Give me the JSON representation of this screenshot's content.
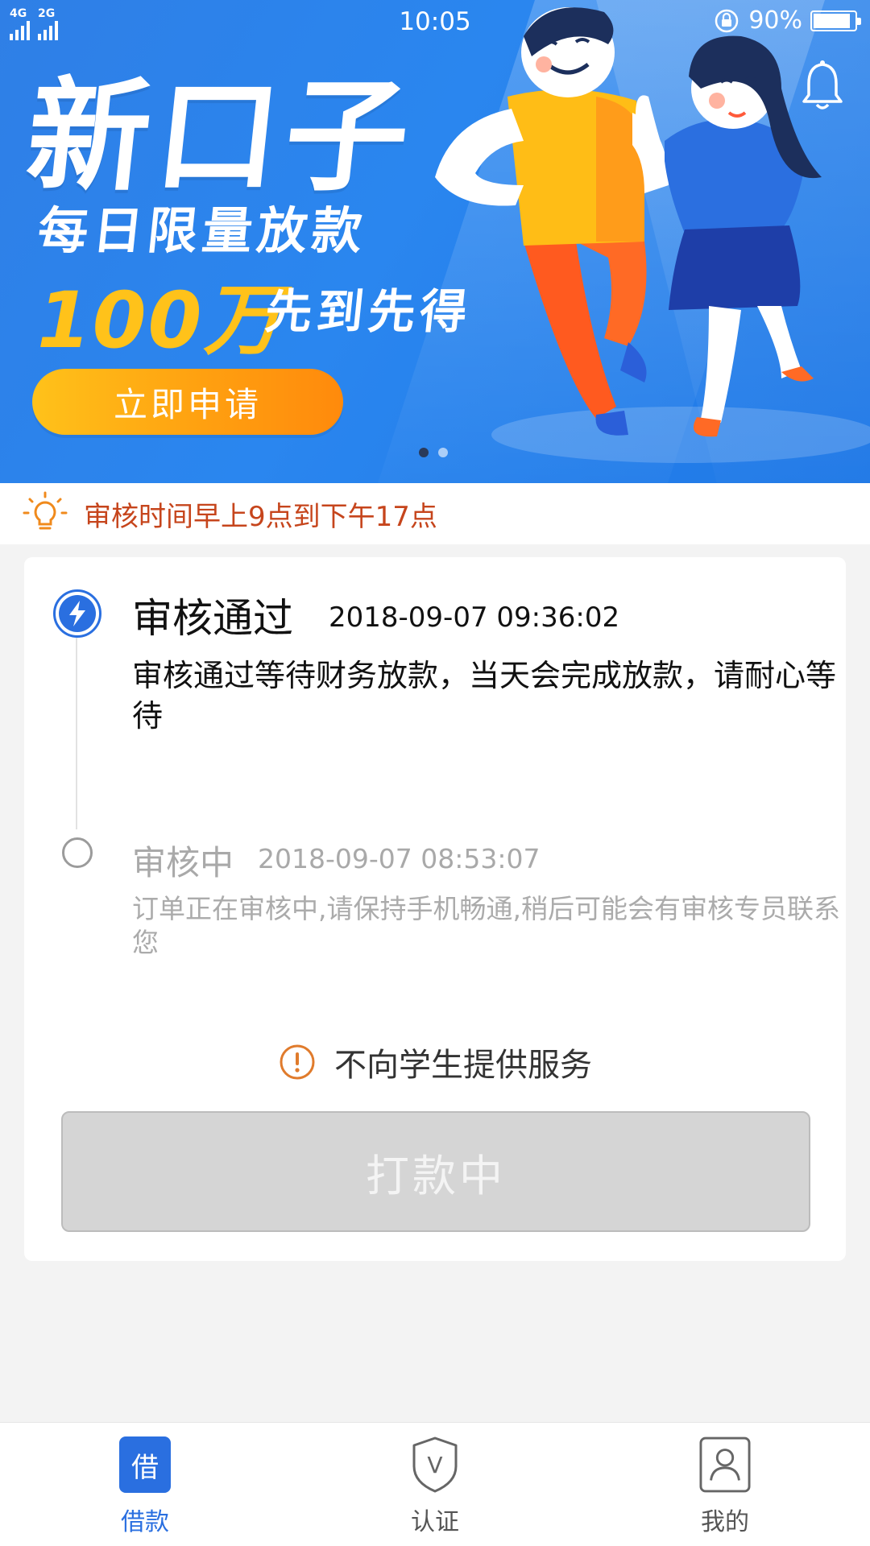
{
  "status_bar": {
    "network_1": "4G",
    "network_2": "2G",
    "time": "10:05",
    "battery": "90%",
    "battery_level": 0.9
  },
  "banner": {
    "title": "新口子",
    "subtitle": "每日限量放款",
    "amount": "100万",
    "amount_suffix": "先到先得",
    "apply_button": "立即申请",
    "slide_count": 2,
    "active_slide": 0
  },
  "notice": {
    "text": "审核时间早上9点到下午17点"
  },
  "timeline": {
    "steps": [
      {
        "title": "审核通过",
        "time": "2018-09-07 09:36:02",
        "desc": "审核通过等待财务放款，当天会完成放款，请耐心等待",
        "active": true
      },
      {
        "title": "审核中",
        "time": "2018-09-07 08:53:07",
        "desc": "订单正在审核中,请保持手机畅通,稍后可能会有审核专员联系您",
        "active": false
      }
    ]
  },
  "warning": {
    "text": "不向学生提供服务"
  },
  "action": {
    "button_label": "打款中",
    "disabled": true
  },
  "bottom_nav": {
    "items": [
      {
        "label": "借款",
        "icon": "loan-icon",
        "icon_char": "借",
        "active": true
      },
      {
        "label": "认证",
        "icon": "shield-v-icon",
        "icon_char": "V",
        "active": false
      },
      {
        "label": "我的",
        "icon": "user-icon",
        "active": false
      }
    ]
  },
  "colors": {
    "primary": "#2a6fe0",
    "banner_bg": "#2a86ef",
    "accent_yellow": "#ffc21a",
    "notice_text": "#c6451c",
    "warning_icon": "#e07b2c"
  }
}
